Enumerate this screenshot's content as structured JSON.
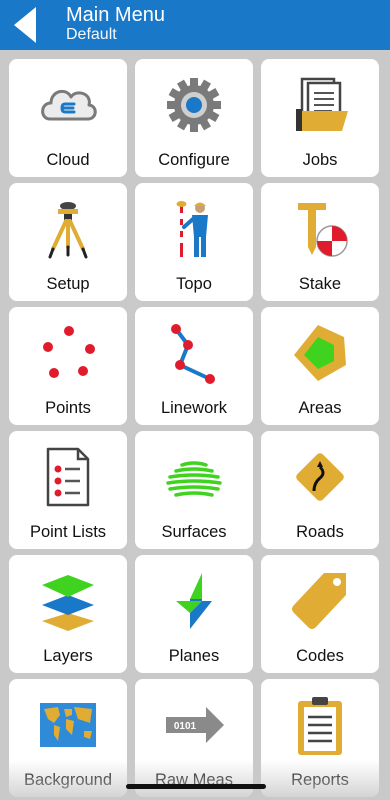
{
  "header": {
    "title": "Main Menu",
    "subtitle": "Default"
  },
  "tiles": [
    {
      "label": "Cloud",
      "icon": "cloud-icon"
    },
    {
      "label": "Configure",
      "icon": "gear-icon"
    },
    {
      "label": "Jobs",
      "icon": "folder-icon"
    },
    {
      "label": "Setup",
      "icon": "tripod-icon"
    },
    {
      "label": "Topo",
      "icon": "surveyor-icon"
    },
    {
      "label": "Stake",
      "icon": "stake-icon"
    },
    {
      "label": "Points",
      "icon": "points-icon"
    },
    {
      "label": "Linework",
      "icon": "linework-icon"
    },
    {
      "label": "Areas",
      "icon": "area-icon"
    },
    {
      "label": "Point Lists",
      "icon": "point-list-icon"
    },
    {
      "label": "Surfaces",
      "icon": "surface-icon"
    },
    {
      "label": "Roads",
      "icon": "road-sign-icon"
    },
    {
      "label": "Layers",
      "icon": "layers-icon"
    },
    {
      "label": "Planes",
      "icon": "planes-icon"
    },
    {
      "label": "Codes",
      "icon": "tag-icon"
    },
    {
      "label": "Background",
      "icon": "world-map-icon"
    },
    {
      "label": "Raw Meas",
      "icon": "raw-data-arrow-icon"
    },
    {
      "label": "Reports",
      "icon": "clipboard-icon"
    }
  ],
  "colors": {
    "header": "#1a78c8",
    "background": "#c9c9c9",
    "tile": "#ffffff",
    "gold": "#e0ac34",
    "red": "#e01b2b",
    "green": "#3fd31f",
    "blue": "#1a78c8"
  }
}
